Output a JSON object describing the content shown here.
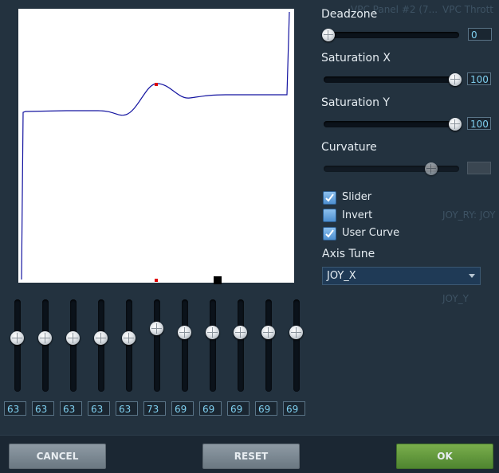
{
  "background_ghost": {
    "text1": "VPC Panel #2 (7...",
    "text2": "VPC Thrott",
    "text3": "JOY_RY: JOY",
    "text4": "JOY_Y"
  },
  "deadzone": {
    "label": "Deadzone",
    "value": "0",
    "level": 0
  },
  "saturation_x": {
    "label": "Saturation X",
    "value": "100",
    "level": 1.0
  },
  "saturation_y": {
    "label": "Saturation Y",
    "value": "100",
    "level": 1.0
  },
  "curvature": {
    "label": "Curvature",
    "value": "",
    "level": 0.8
  },
  "checkboxes": [
    {
      "label": "Slider",
      "checked": true
    },
    {
      "label": "Invert",
      "checked": false
    },
    {
      "label": "User Curve",
      "checked": true
    }
  ],
  "axis_tune": {
    "label": "Axis Tune",
    "selected": "JOY_X"
  },
  "curve_points": [
    63,
    63,
    63,
    63,
    63,
    73,
    69,
    69,
    69,
    69,
    69
  ],
  "curve_point_labels": [
    "63",
    "63",
    "63",
    "63",
    "63",
    "73",
    "69",
    "69",
    "69",
    "69",
    "69"
  ],
  "buttons": {
    "cancel": "CANCEL",
    "reset": "RESET",
    "ok": "OK"
  },
  "colors": {
    "curve": "#1414a0",
    "ok_button": "#5f9a3a",
    "accent_text": "#7fd0f0"
  }
}
